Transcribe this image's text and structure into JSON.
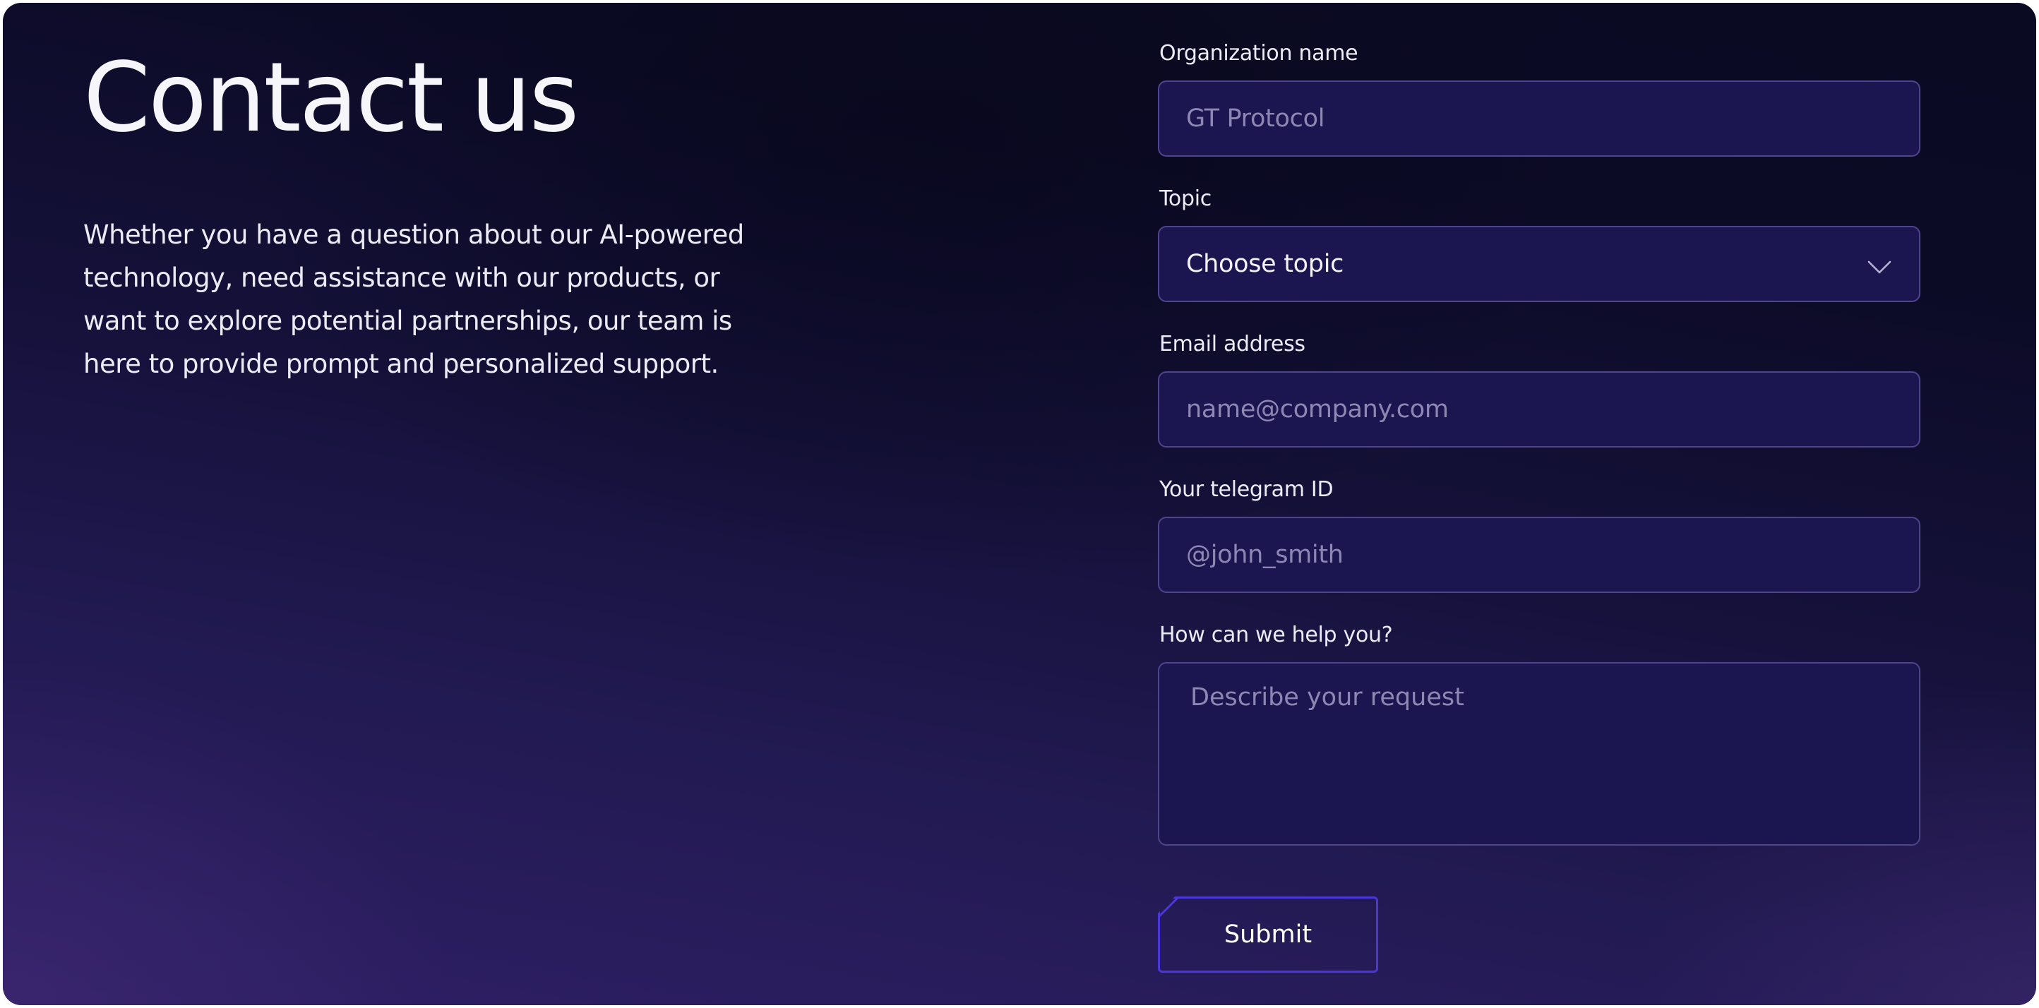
{
  "contact": {
    "title": "Contact us",
    "description": "Whether you have a question about our AI-powered technology, need assistance with our products, or want to explore potential partnerships, our team is here to provide prompt and personalized support."
  },
  "form": {
    "organization": {
      "label": "Organization name",
      "placeholder": "GT Protocol"
    },
    "topic": {
      "label": "Topic",
      "value": "Choose topic",
      "icon": "chevron-down-icon"
    },
    "email": {
      "label": "Email address",
      "placeholder": "name@company.com"
    },
    "telegram": {
      "label": "Your telegram ID",
      "placeholder": "@john_smith"
    },
    "message": {
      "label": "How can we help you?",
      "placeholder": "Describe your request"
    },
    "submit_label": "Submit"
  },
  "colors": {
    "background_top": "#0a0a22",
    "background_bottom": "#2f1f66",
    "input_background": "#1b1550",
    "input_border": "#5a5295",
    "accent": "#4b36d8",
    "text": "#f5f5fa",
    "placeholder": "#8d88b3"
  }
}
